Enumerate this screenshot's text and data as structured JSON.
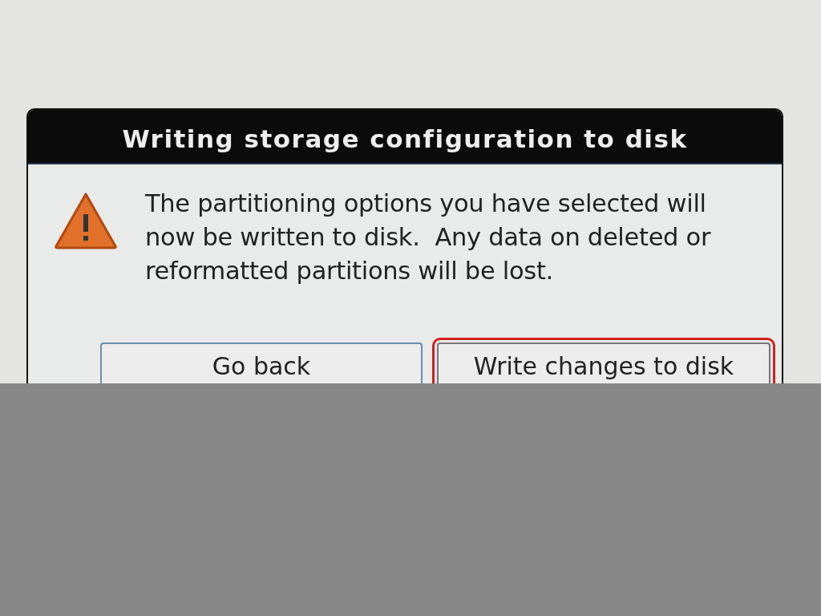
{
  "dialog": {
    "title": "Writing storage configuration to disk",
    "message": "The partitioning options you have selected will now be written to disk.  Any data on deleted or reformatted partitions will be lost.",
    "buttons": [
      {
        "label": "Go back",
        "focused": false
      },
      {
        "label": "Write changes to disk",
        "focused": true
      }
    ]
  }
}
